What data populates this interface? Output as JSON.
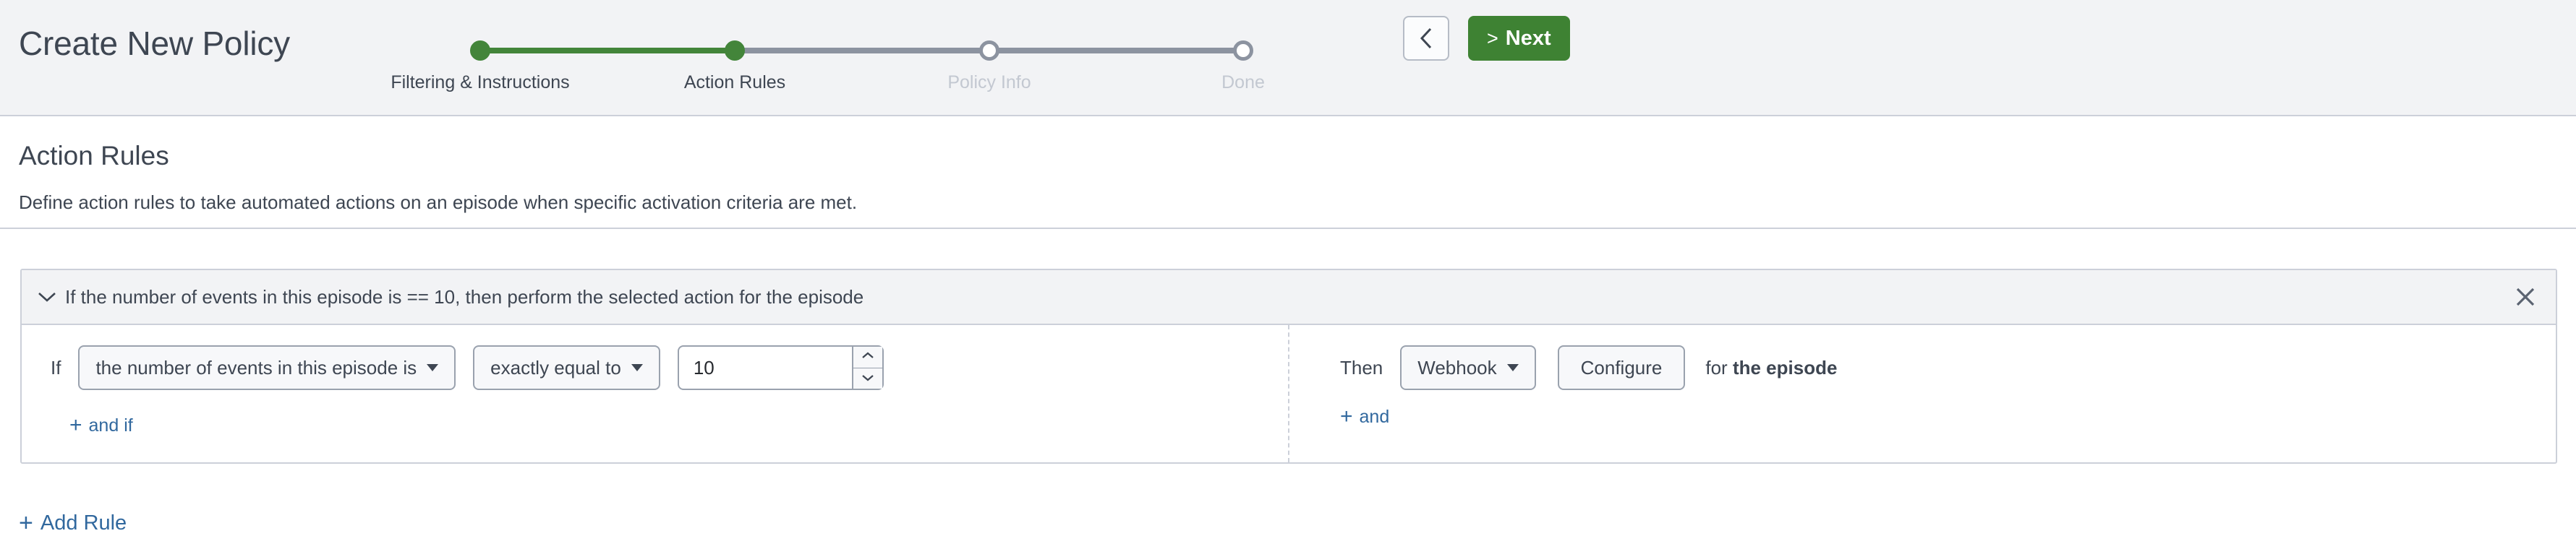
{
  "header": {
    "title": "Create New Policy",
    "back_button": {
      "icon": "chevron-left-icon",
      "label": ""
    },
    "next_button": {
      "label": "Next",
      "chevron": ">",
      "color": "#3e8233"
    }
  },
  "stepper": {
    "active_index": 1,
    "steps": [
      {
        "label": "Filtering & Instructions",
        "state": "done"
      },
      {
        "label": "Action Rules",
        "state": "current"
      },
      {
        "label": "Policy Info",
        "state": "future"
      },
      {
        "label": "Done",
        "state": "future"
      }
    ],
    "colors": {
      "done": "#43853a",
      "pending": "#8c93a0",
      "future_text": "#c3c8d1"
    }
  },
  "section": {
    "title": "Action Rules",
    "description": "Define action rules to take automated actions on an episode when specific activation criteria are met."
  },
  "rule_card": {
    "collapse_icon": "chevron-down-icon",
    "summary": "If the number of events in this episode is == 10, then perform the selected action for the episode",
    "close_icon": "close-icon",
    "if_column": {
      "lead_label": "If",
      "subject_dropdown": {
        "value": "the number of events in this episode is",
        "caret": "chevron-down-icon"
      },
      "operator_dropdown": {
        "value": "exactly equal to",
        "caret": "chevron-down-icon"
      },
      "value_input": {
        "value": "10",
        "placeholder": "",
        "increment_icon": "chevron-up-icon",
        "decrement_icon": "chevron-down-icon"
      },
      "add_link": {
        "plus": "+",
        "label": "and if"
      }
    },
    "then_column": {
      "lead_label": "Then",
      "action_dropdown": {
        "value": "Webhook",
        "caret": "chevron-down-icon"
      },
      "configure_button": "Configure",
      "for_prefix": "for",
      "for_target": "the episode",
      "add_link": {
        "plus": "+",
        "label": "and"
      }
    }
  },
  "footer": {
    "add_rule": {
      "plus": "+",
      "label": "Add Rule"
    }
  },
  "colors": {
    "accent_green": "#3e8233",
    "link_blue": "#31689e",
    "text": "#3e4652",
    "border": "#ccd0d9",
    "band_bg": "#f2f3f5"
  }
}
